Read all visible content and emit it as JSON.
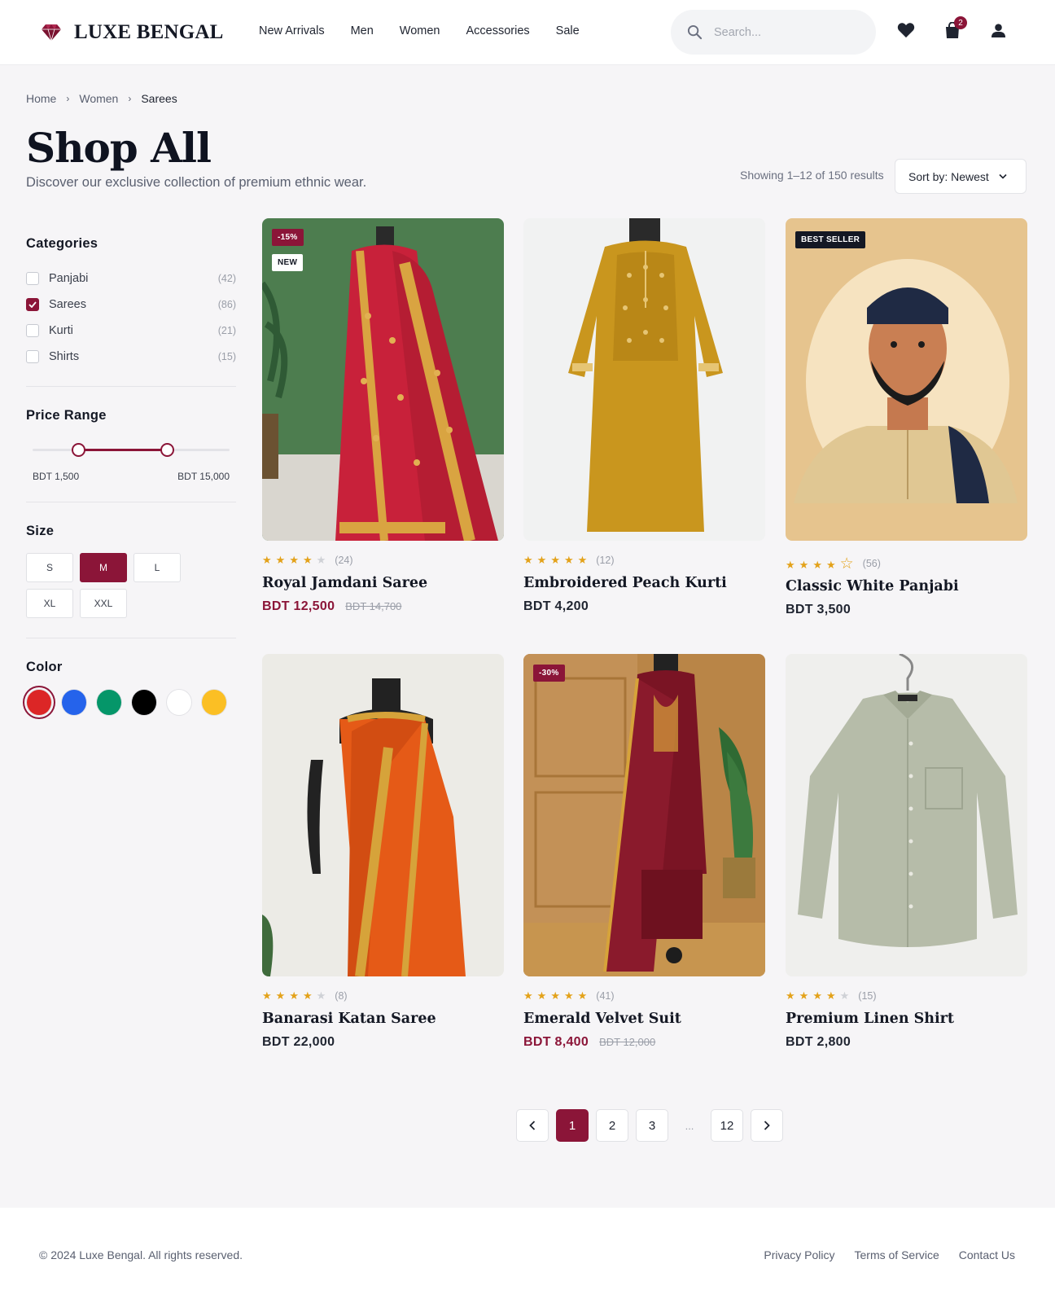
{
  "brand": {
    "name": "LUXE BENGAL",
    "accent": "#8b1538"
  },
  "nav": [
    "New Arrivals",
    "Men",
    "Women",
    "Accessories",
    "Sale"
  ],
  "search": {
    "placeholder": "Search..."
  },
  "header_icons": [
    "search-icon",
    "heart-icon",
    "shopping-bag-icon",
    "user-icon"
  ],
  "cart": {
    "count": "2"
  },
  "breadcrumb": [
    "Home",
    "Women",
    "Sarees"
  ],
  "page": {
    "title": "Shop All",
    "subtitle": "Discover our exclusive collection of premium ethnic wear.",
    "results": "Showing 1–12 of 150 results",
    "sort_label": "Sort by: Newest"
  },
  "filters": {
    "categories_heading": "Categories",
    "categories": [
      {
        "label": "Panjabi",
        "count": "(42)",
        "checked": false
      },
      {
        "label": "Sarees",
        "count": "(86)",
        "checked": true
      },
      {
        "label": "Kurti",
        "count": "(21)",
        "checked": false
      },
      {
        "label": "Shirts",
        "count": "(15)",
        "checked": false
      }
    ],
    "price_heading": "Price Range",
    "price_min_label": "BDT 1,500",
    "price_max_label": "BDT 15,000",
    "price_range_fraction": [
      0.23,
      0.68
    ],
    "size_heading": "Size",
    "sizes": [
      {
        "label": "S",
        "active": false
      },
      {
        "label": "M",
        "active": true
      },
      {
        "label": "L",
        "active": false
      },
      {
        "label": "XL",
        "active": false
      },
      {
        "label": "XXL",
        "active": false
      }
    ],
    "color_heading": "Color",
    "colors": [
      {
        "name": "red",
        "hex": "#dc2626",
        "selected": true
      },
      {
        "name": "blue",
        "hex": "#2563eb",
        "selected": false
      },
      {
        "name": "green",
        "hex": "#059669",
        "selected": false
      },
      {
        "name": "black",
        "hex": "#000000",
        "selected": false
      },
      {
        "name": "white",
        "hex": "#ffffff",
        "selected": false
      },
      {
        "name": "yellow",
        "hex": "#fbbf24",
        "selected": false
      }
    ]
  },
  "products": [
    {
      "name": "Royal Jamdani Saree",
      "price": "BDT 12,500",
      "old_price": "BDT 14,700",
      "on_sale": true,
      "rating": 4,
      "reviews": "(24)",
      "badge_discount": "-15%",
      "badge_new": "NEW",
      "image": "red-saree-on-mannequin"
    },
    {
      "name": "Embroidered Peach Kurti",
      "price": "BDT 4,200",
      "old_price": "",
      "on_sale": false,
      "rating": 5,
      "reviews": "(12)",
      "image": "mustard-kurti-on-mannequin"
    },
    {
      "name": "Classic White Panjabi",
      "price": "BDT 3,500",
      "old_price": "",
      "on_sale": false,
      "rating": 4.5,
      "reviews": "(56)",
      "badge_best": "BEST SELLER",
      "image": "illustrated-man-in-panjabi"
    },
    {
      "name": "Banarasi Katan Saree",
      "price": "BDT 22,000",
      "old_price": "",
      "on_sale": false,
      "rating": 4,
      "reviews": "(8)",
      "image": "orange-saree-on-mannequin"
    },
    {
      "name": "Emerald Velvet Suit",
      "price": "BDT 8,400",
      "old_price": "BDT 12,000",
      "on_sale": true,
      "rating": 5,
      "reviews": "(41)",
      "badge_discount": "-30%",
      "image": "maroon-velvet-suit"
    },
    {
      "name": "Premium Linen Shirt",
      "price": "BDT 2,800",
      "old_price": "",
      "on_sale": false,
      "rating": 4,
      "reviews": "(15)",
      "image": "sage-linen-shirt-on-hanger"
    }
  ],
  "pagination": {
    "pages": [
      "1",
      "2",
      "3",
      "12"
    ],
    "ellipsis": "...",
    "current": "1"
  },
  "footer": {
    "copyright": "© 2024 Luxe Bengal. All rights reserved.",
    "links": [
      "Privacy Policy",
      "Terms of Service",
      "Contact Us"
    ]
  }
}
